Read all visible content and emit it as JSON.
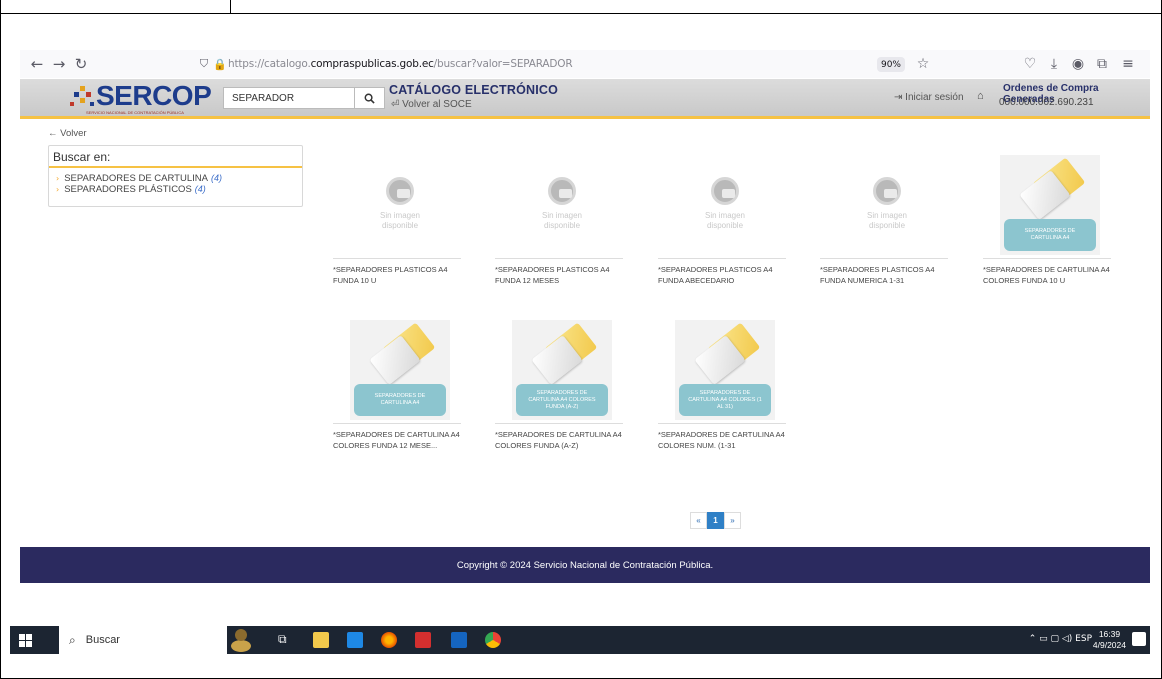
{
  "browser": {
    "url_prefix": "https://catalogo.",
    "url_domain": "compraspublicas.gob.ec",
    "url_path": "/buscar?valor=SEPARADOR",
    "zoom": "90%"
  },
  "header": {
    "logo_text": "SERCOP",
    "logo_subtitle": "SERVICIO NACIONAL DE CONTRATACIÓN PÚBLICA",
    "search_value": "SEPARADOR",
    "catalog_title": "CATÁLOGO ELECTRÓNICO",
    "back_to_soce": "Volver al SOCE",
    "login_label": "Iniciar sesión",
    "orders_title": "Ordenes de Compra Generadas",
    "orders_number": "000.000.002.690.231",
    "accent_color": "#f6c244"
  },
  "sidebar": {
    "back_label": "Volver",
    "panel_title": "Buscar en:",
    "items": [
      {
        "label": "SEPARADORES DE CARTULINA",
        "count": "(4)"
      },
      {
        "label": "SEPARADORES PLÁSTICOS",
        "count": "(4)"
      }
    ]
  },
  "products": [
    {
      "name": "*SEPARADORES PLASTICOS A4 FUNDA 10 U",
      "image": "no-image",
      "image_text_1": "Sin imagen",
      "image_text_2": "disponible"
    },
    {
      "name": "*SEPARADORES PLASTICOS A4 FUNDA 12 MESES",
      "image": "no-image",
      "image_text_1": "Sin imagen",
      "image_text_2": "disponible"
    },
    {
      "name": "*SEPARADORES PLASTICOS A4 FUNDA ABECEDARIO",
      "image": "no-image",
      "image_text_1": "Sin imagen",
      "image_text_2": "disponible"
    },
    {
      "name": "*SEPARADORES PLASTICOS A4 FUNDA NUMERICA 1-31",
      "image": "no-image",
      "image_text_1": "Sin imagen",
      "image_text_2": "disponible"
    },
    {
      "name": "*SEPARADORES DE CARTULINA A4 COLORES FUNDA 10 U",
      "image": "folder",
      "image_label": "SEPARADORES DE CARTULINA A4"
    },
    {
      "name": "*SEPARADORES DE CARTULINA A4 COLORES FUNDA 12 MESE...",
      "image": "folder",
      "image_label": "SEPARADORES DE CARTULINA A4"
    },
    {
      "name": "*SEPARADORES DE CARTULINA A4 COLORES FUNDA (A-Z)",
      "image": "folder",
      "image_label": "SEPARADORES DE CARTULINA A4 COLORES FUNDA (A-Z)"
    },
    {
      "name": "*SEPARADORES DE CARTULINA A4 COLORES NUM. (1-31",
      "image": "folder",
      "image_label": "SEPARADORES DE CARTULINA A4 COLORES (1 AL 31)"
    }
  ],
  "pagination": {
    "prev": "«",
    "current": "1",
    "next": "»"
  },
  "footer": {
    "copyright": "Copyright © 2024 Servicio Nacional de Contratación Pública."
  },
  "taskbar": {
    "search_placeholder": "Buscar",
    "tray_text": "ESP",
    "time": "16:39",
    "date": "4/9/2024"
  }
}
